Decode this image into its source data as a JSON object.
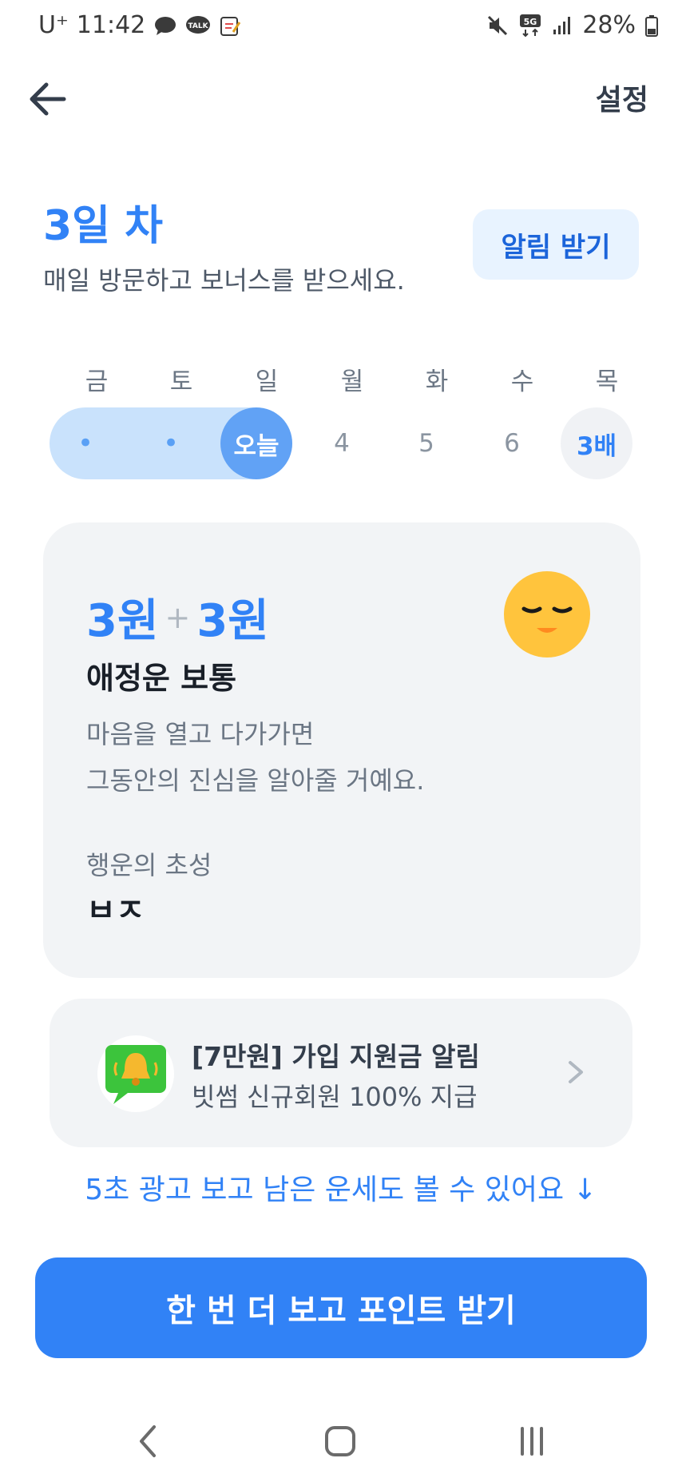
{
  "status_bar": {
    "carrier": "U⁺",
    "time": "11:42",
    "network": "5G",
    "battery": "28%",
    "icons": [
      "chat-bubble-icon",
      "talk-icon",
      "note-icon",
      "mute-icon",
      "signal-icon",
      "battery-icon"
    ]
  },
  "header": {
    "back_icon": "arrow-left-icon",
    "settings_label": "설정"
  },
  "attendance": {
    "title": "3일 차",
    "subtitle": "매일 방문하고 보너스를 받으세요.",
    "alarm_button": "알림 받기",
    "days": [
      {
        "label": "금",
        "value": "•",
        "state": "done"
      },
      {
        "label": "토",
        "value": "•",
        "state": "done"
      },
      {
        "label": "일",
        "value": "오늘",
        "state": "today"
      },
      {
        "label": "월",
        "value": "4",
        "state": "future"
      },
      {
        "label": "화",
        "value": "5",
        "state": "future"
      },
      {
        "label": "수",
        "value": "6",
        "state": "future"
      },
      {
        "label": "목",
        "value": "3배",
        "state": "bonus"
      }
    ]
  },
  "fortune": {
    "points_a": "3원",
    "plus": "+",
    "points_b": "3원",
    "face_icon": "sleepy-face-icon",
    "label": "애정운 보통",
    "desc_line1": "마음을 열고 다가가면",
    "desc_line2": "그동안의 진심을 알아줄 거예요.",
    "lucky_label": "행운의 초성",
    "lucky_value": "ㅂㅈ"
  },
  "ad": {
    "icon": "bell-icon",
    "title": "[7만원] 가입 지원금 알림",
    "subtitle": "빗썸 신규회원 100% 지급",
    "chevron_icon": "chevron-right-icon"
  },
  "more_link": "5초 광고 보고 남은 운세도 볼 수 있어요 ↓",
  "cta_label": "한 번 더 보고 포인트 받기",
  "nav": {
    "back_icon": "nav-back-icon",
    "home_icon": "nav-home-icon",
    "recents_icon": "nav-recents-icon"
  },
  "colors": {
    "accent": "#3182f6",
    "streak": "#c9e2fc",
    "today": "#61a2f5",
    "card": "#f2f4f6"
  }
}
